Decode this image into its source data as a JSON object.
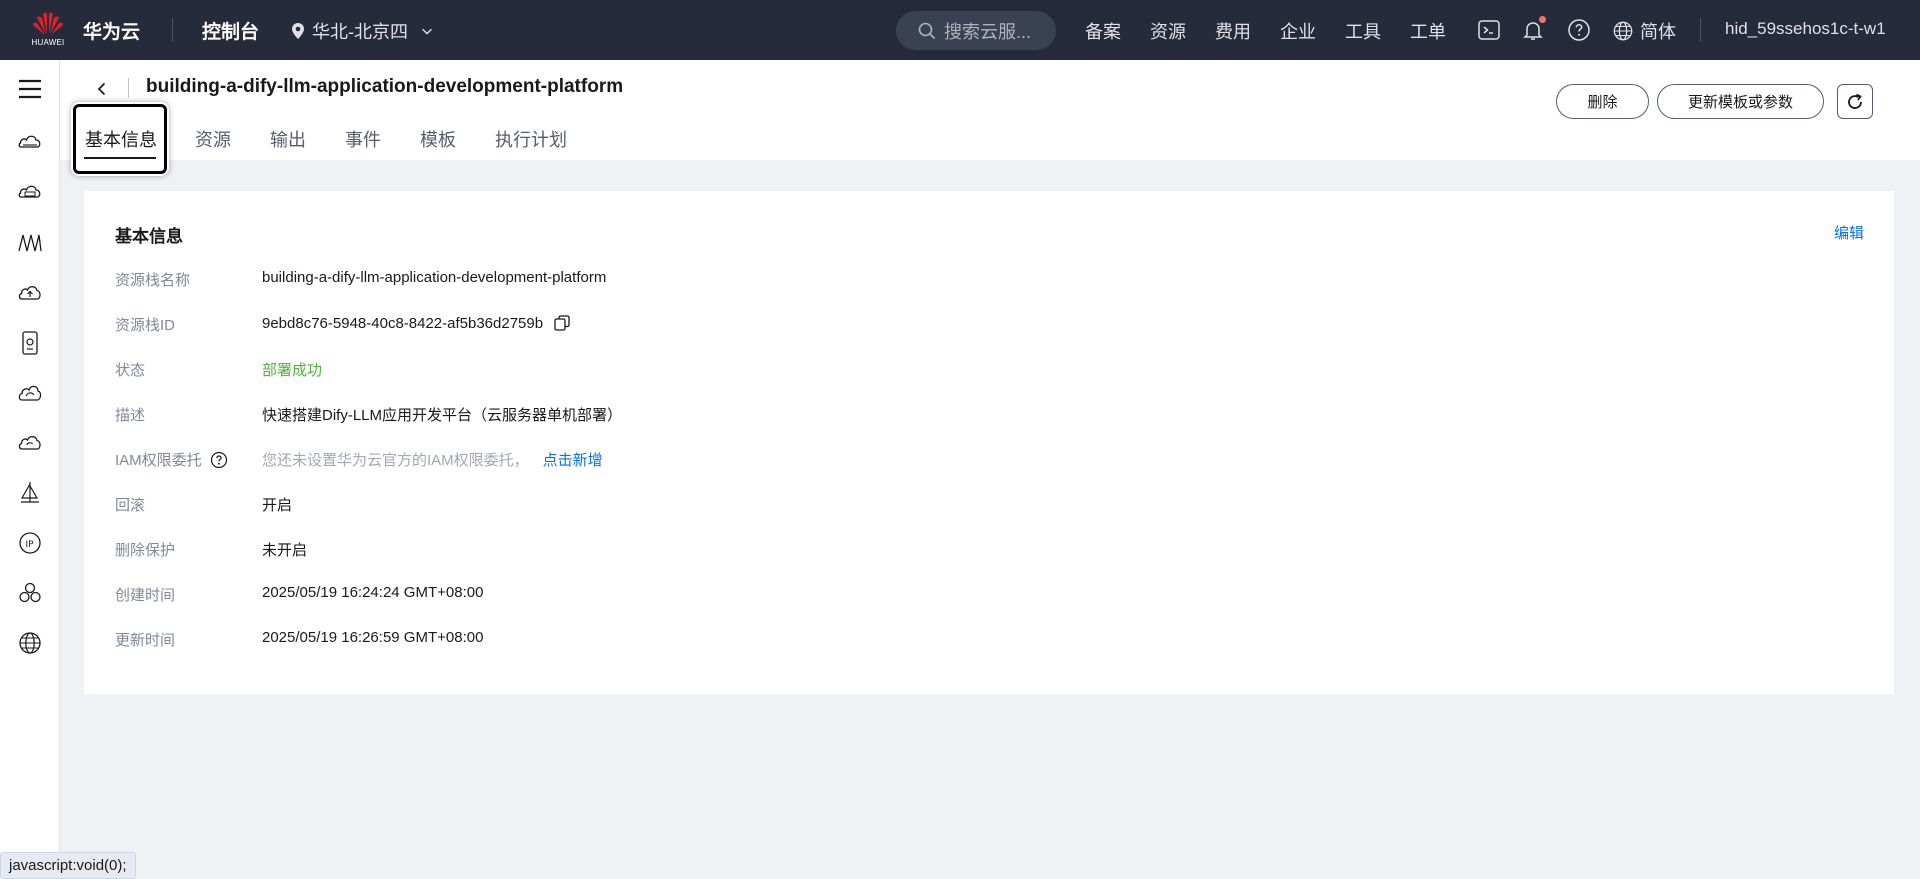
{
  "header": {
    "logo_text": "HUAWEI",
    "brand": "华为云",
    "console": "控制台",
    "region": "华北-北京四",
    "search_placeholder": "搜索云服...",
    "nav": [
      "备案",
      "资源",
      "费用",
      "企业",
      "工具",
      "工单"
    ],
    "language": "简体",
    "user": "hid_59ssehos1c-t-w1"
  },
  "sidebar": {
    "icons": [
      "menu-icon",
      "cloud-server-icon",
      "server-box-icon",
      "network-icon",
      "cloud-upload-icon",
      "storage-icon",
      "cloud-icon",
      "cloud-sync-icon",
      "sail-icon",
      "ip-icon",
      "cluster-icon",
      "globe-icon"
    ]
  },
  "page": {
    "title": "building-a-dify-llm-application-development-platform",
    "tabs": [
      "基本信息",
      "资源",
      "输出",
      "事件",
      "模板",
      "执行计划"
    ],
    "active_tab": "基本信息",
    "delete_label": "删除",
    "update_label": "更新模板或参数"
  },
  "card": {
    "title": "基本信息",
    "edit": "编辑",
    "rows": [
      {
        "label": "资源栈名称",
        "value": "building-a-dify-llm-application-development-platform"
      },
      {
        "label": "资源栈ID",
        "value": "9ebd8c76-5948-40c8-8422-af5b36d2759b"
      },
      {
        "label": "状态",
        "value": "部署成功"
      },
      {
        "label": "描述",
        "value": "快速搭建Dify-LLM应用开发平台（云服务器单机部署）"
      },
      {
        "label": "IAM权限委托",
        "value": "您还未设置华为云官方的IAM权限委托，",
        "link": "点击新增"
      },
      {
        "label": "回滚",
        "value": "开启"
      },
      {
        "label": "删除保护",
        "value": "未开启"
      },
      {
        "label": "创建时间",
        "value": "2025/05/19 16:24:24 GMT+08:00"
      },
      {
        "label": "更新时间",
        "value": "2025/05/19 16:26:59 GMT+08:00"
      }
    ]
  },
  "statusbar": "javascript:void(0);",
  "colors": {
    "header_bg": "#252b3a",
    "link": "#0b70e6",
    "success": "#50b23c",
    "notification_dot": "#f66f6a"
  }
}
